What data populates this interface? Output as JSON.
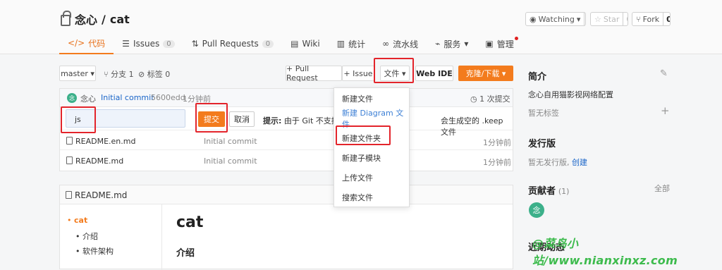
{
  "repo": {
    "owner": "念心",
    "sep": " / ",
    "name": "cat"
  },
  "header_actions": {
    "watch_label": "Watching",
    "watch_count": "1",
    "star_label": "Star",
    "star_count": "0",
    "fork_label": "Fork",
    "fork_count": "0"
  },
  "tabs": [
    {
      "label": "代码",
      "icon": "code-icon"
    },
    {
      "label": "Issues",
      "badge": "0",
      "icon": "issues-icon"
    },
    {
      "label": "Pull Requests",
      "badge": "0",
      "icon": "pull-request-icon"
    },
    {
      "label": "Wiki",
      "icon": "wiki-icon"
    },
    {
      "label": "统计",
      "icon": "stats-icon"
    },
    {
      "label": "流水线",
      "icon": "pipeline-icon"
    },
    {
      "label": "服务",
      "icon": "service-icon"
    },
    {
      "label": "管理",
      "icon": "manage-icon"
    }
  ],
  "toolbar": {
    "branch": "master",
    "branches": "分支 1",
    "tags": "标签 0",
    "pull_request": "+ Pull Request",
    "issue": "+ Issue",
    "file_menu": "文件",
    "web_ide": "Web IDE",
    "clone": "克隆/下载"
  },
  "commit_bar": {
    "author": "念心",
    "message": "Initial commit",
    "hash": "5600edd",
    "time": "1分钟前",
    "count": "1 次提交"
  },
  "new_folder": {
    "value": "js",
    "submit": "提交",
    "cancel": "取消",
    "tip_label": "提示:",
    "tip_text": "由于 Git 不支持空",
    "tip_tail": "会生成空的 .keep 文件"
  },
  "files": [
    {
      "name": "README.en.md",
      "commit": "Initial commit",
      "time": "1分钟前"
    },
    {
      "name": "README.md",
      "commit": "Initial commit",
      "time": "1分钟前"
    }
  ],
  "file_menu_items": [
    "新建文件",
    "新建 Diagram 文件",
    "新建文件夹",
    "新建子模块",
    "上传文件",
    "搜索文件"
  ],
  "readme": {
    "filename": "README.md",
    "toc": [
      "cat",
      "介绍",
      "软件架构"
    ],
    "heading": "cat",
    "subheading": "介绍"
  },
  "sidebar": {
    "intro_title": "简介",
    "intro_text": "念心自用猫影视网络配置",
    "no_tags": "暂无标签",
    "release_title": "发行版",
    "no_release": "暂无发行版,",
    "create": "创建",
    "contributors_title": "贡献者",
    "contributors_count": "(1)",
    "all": "全部",
    "contributor_avatar": "念",
    "recent_title": "近期动态"
  },
  "watermark": "@菜鸟小站/www.nianxinxz.com",
  "colors": {
    "accent": "#f37b1d",
    "link": "#1a65c8",
    "highlight_box": "#e3242b",
    "avatar": "#3cb08a"
  }
}
